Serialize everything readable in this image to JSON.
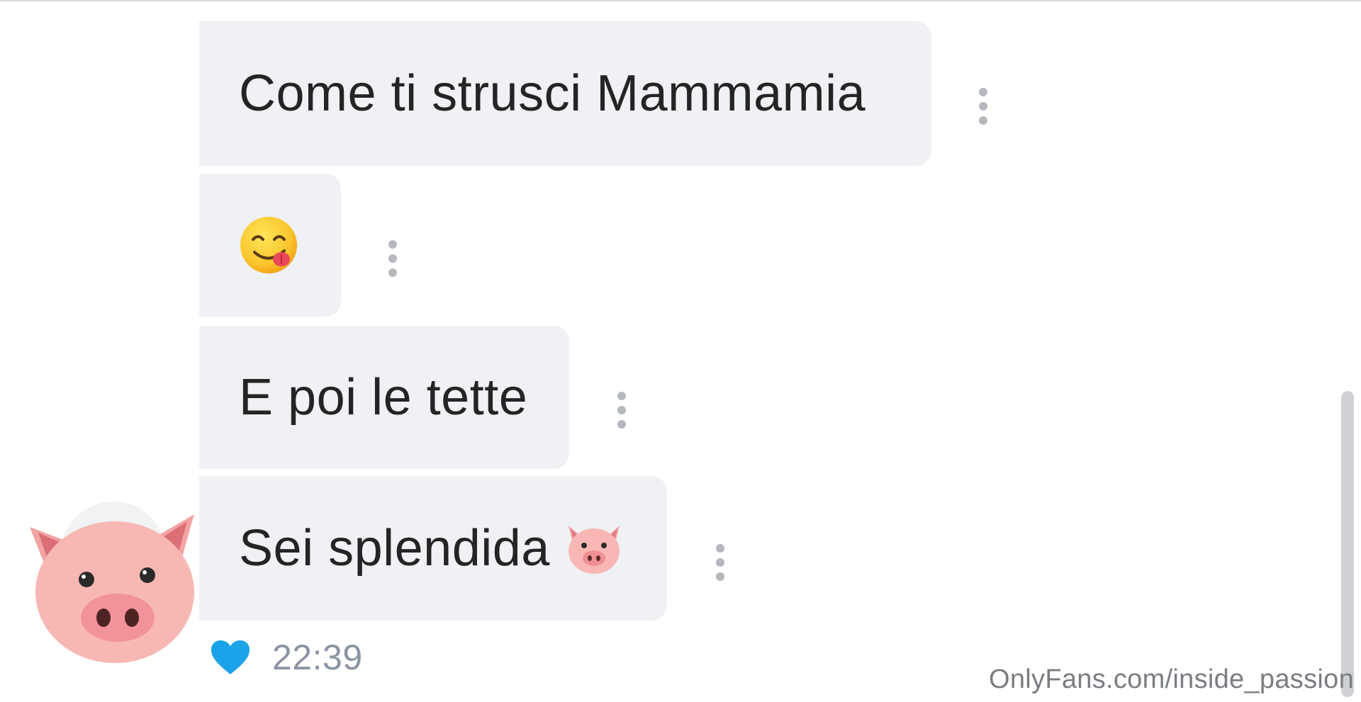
{
  "messages": [
    {
      "text": "Come ti strusci Mammamia",
      "emoji": ""
    },
    {
      "text": "",
      "emoji": "savoring-food-face"
    },
    {
      "text": "E poi le tette",
      "emoji": ""
    },
    {
      "text": "Sei splendida",
      "emoji": "pig-face"
    }
  ],
  "message_meta": {
    "time": "22:39",
    "like_icon": "heart-icon",
    "like_color": "#1aa3e8"
  },
  "sender": {
    "avatar_icon": "pig-face"
  },
  "colors": {
    "bubble_background": "#eff1f4",
    "text": "#242424",
    "menu_dots": "#b5b9bf",
    "time_text": "#8a94a3"
  },
  "watermark": "OnlyFans.com/inside_passion"
}
